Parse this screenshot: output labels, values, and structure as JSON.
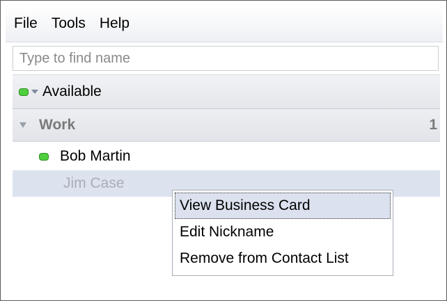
{
  "menubar": {
    "items": [
      "File",
      "Tools",
      "Help"
    ]
  },
  "search": {
    "placeholder": "Type to find name",
    "value": ""
  },
  "status": {
    "label": "Available",
    "color": "#4fcf3e"
  },
  "group": {
    "name": "Work",
    "count": "1"
  },
  "contacts": [
    {
      "name": "Bob Martin",
      "status": "available"
    },
    {
      "name": "Jim Case",
      "status": "offline"
    }
  ],
  "context_menu": {
    "items": [
      "View Business Card",
      "Edit Nickname",
      "Remove from Contact List"
    ],
    "active_index": 0
  }
}
